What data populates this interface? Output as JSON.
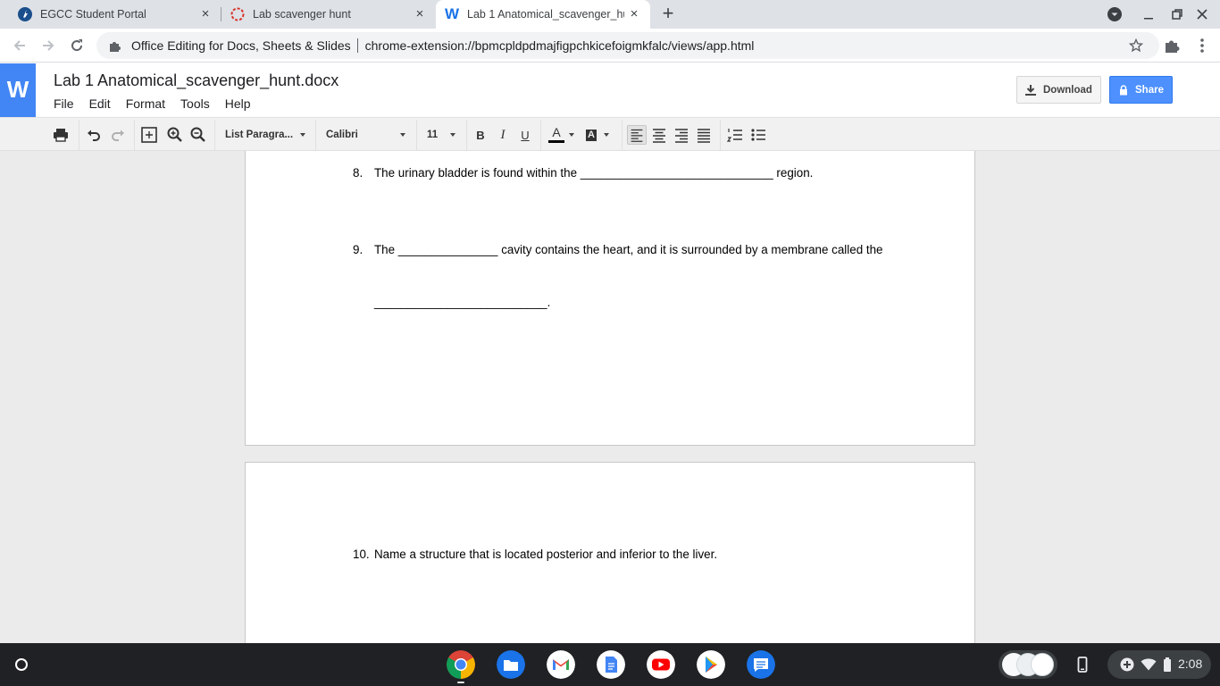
{
  "browser": {
    "tabs": [
      {
        "title": "EGCC Student Portal",
        "icon": "egcc-favicon"
      },
      {
        "title": "Lab scavenger hunt",
        "icon": "lab-favicon"
      },
      {
        "title": "Lab 1 Anatomical_scavenger_hu",
        "icon": "word-favicon",
        "active": true
      }
    ],
    "new_tab_symbol": "+",
    "close_symbol": "×",
    "omnibox": {
      "origin": "Office Editing for Docs, Sheets & Slides",
      "url": "chrome-extension://bpmcpldpdmajfigpchkicefoigmkfalc/views/app.html"
    }
  },
  "app": {
    "logo": "W",
    "doc_title": "Lab 1 Anatomical_scavenger_hunt.docx",
    "menu": [
      "File",
      "Edit",
      "Format",
      "Tools",
      "Help"
    ],
    "download_label": "Download",
    "share_label": "Share"
  },
  "toolbar": {
    "paragraph_style": "List Paragra...",
    "font_family": "Calibri",
    "font_size": "11",
    "bold": "B",
    "italic": "I",
    "underline": "U",
    "text_color_glyph": "A",
    "highlight_glyph": "A",
    "text_color": "#000000"
  },
  "document": {
    "q8": {
      "num": "8.",
      "text": "The urinary bladder is found within the _____________________________ region."
    },
    "q9a": {
      "num": "9.",
      "text": "The _______________ cavity contains the heart, and it is surrounded by a membrane called the"
    },
    "q9b": {
      "text": "__________________________."
    },
    "q10": {
      "num": "10.",
      "text": "Name a structure that is located posterior and inferior to the liver."
    }
  },
  "shelf": {
    "apps": [
      "chrome-icon",
      "files-icon",
      "gmail-icon",
      "docs-icon",
      "youtube-icon",
      "play-store-icon",
      "messages-icon"
    ],
    "time": "2:08"
  }
}
